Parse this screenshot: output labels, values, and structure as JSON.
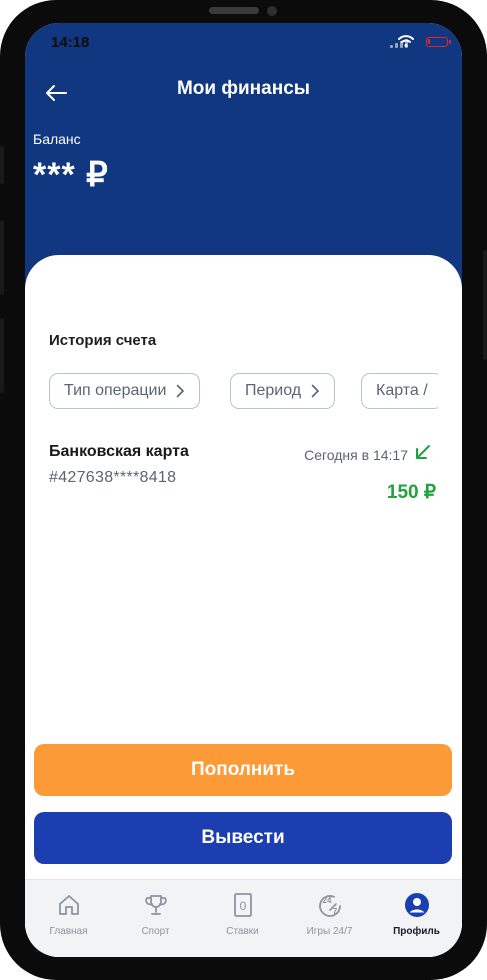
{
  "status": {
    "time": "14:18"
  },
  "header": {
    "title": "Мои финансы",
    "back_icon": "arrow-left-icon"
  },
  "balance": {
    "label": "Баланс",
    "value": "*** ₽"
  },
  "history": {
    "title": "История счета",
    "filters": [
      {
        "label": "Тип операции"
      },
      {
        "label": "Период"
      },
      {
        "label": "Карта /"
      }
    ],
    "transactions": [
      {
        "name": "Банковская карта",
        "card": "#427638****8418",
        "date": "Сегодня в 14:17",
        "amount": "150 ₽",
        "direction_icon": "arrow-down-left-icon"
      }
    ]
  },
  "actions": {
    "deposit": "Пополнить",
    "withdraw": "Вывести"
  },
  "tabs": [
    {
      "label": "Главная",
      "icon": "home-icon"
    },
    {
      "label": "Спорт",
      "icon": "trophy-icon"
    },
    {
      "label": "Ставки",
      "icon": "betslip-icon",
      "badge": "0"
    },
    {
      "label": "Игры 24/7",
      "icon": "games-24-7-icon",
      "badge": "24"
    },
    {
      "label": "Профиль",
      "icon": "profile-icon",
      "active": true
    }
  ],
  "colors": {
    "header_bg": "#10377f",
    "deposit": "#fb9a36",
    "withdraw": "#1b3fb0",
    "amount_positive": "#22a23b"
  }
}
